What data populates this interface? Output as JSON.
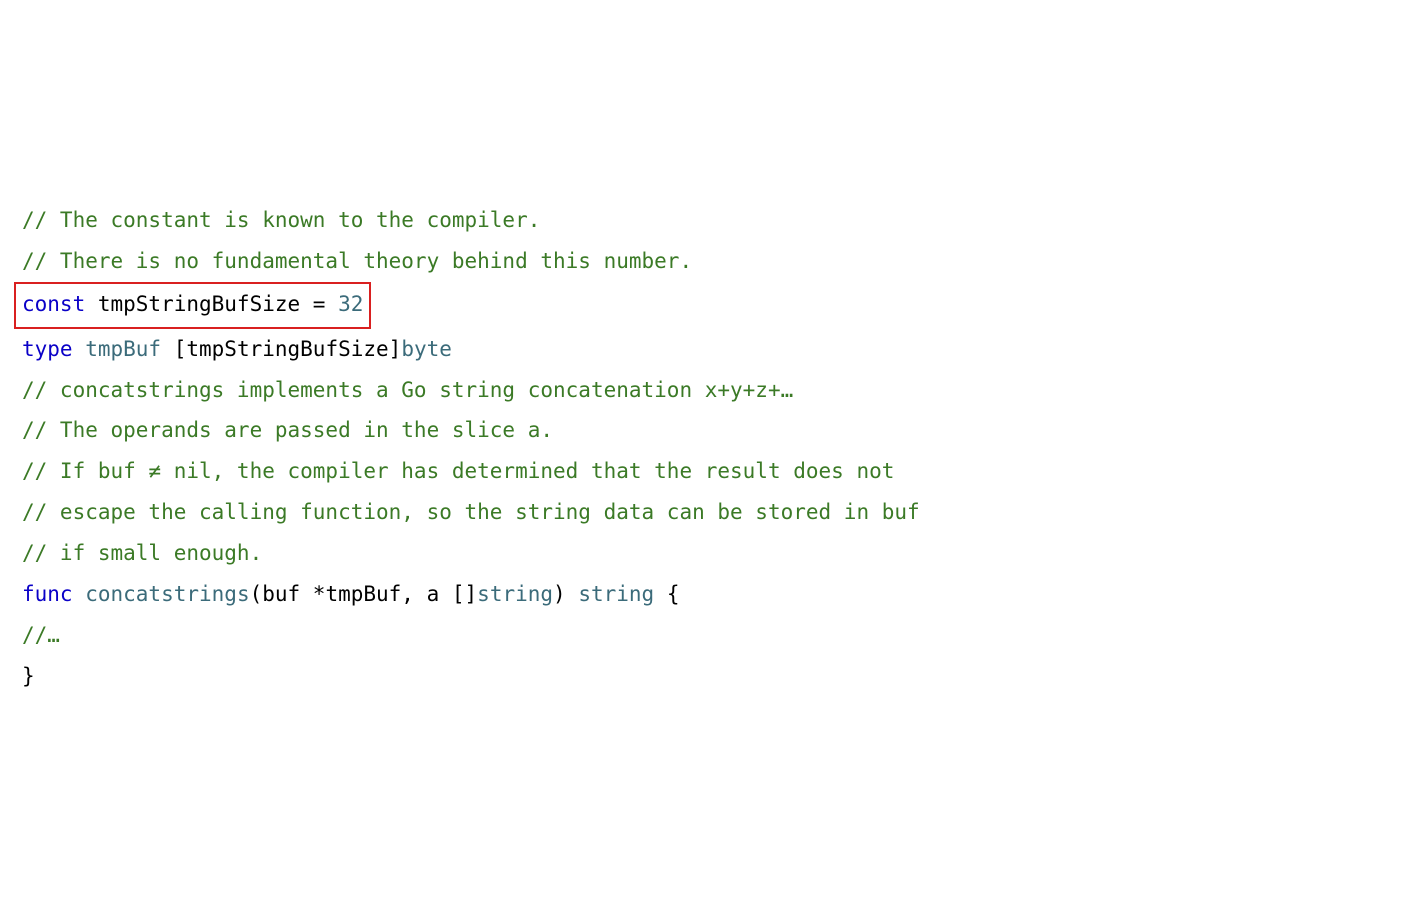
{
  "code": {
    "c1": "// The constant is known to the compiler.",
    "c2": "// There is no fundamental theory behind this number.",
    "kw_const": "const",
    "const_name": " tmpStringBufSize ",
    "eq": "= ",
    "const_val": "32",
    "blank": "",
    "kw_type": "type",
    "type_name": " tmpBuf",
    "type_body_open": " [tmpStringBufSize]",
    "type_byte": "byte",
    "c3": "// concatstrings implements a Go string concatenation x+y+z+…",
    "c4": "// The operands are passed in the slice a.",
    "c5": "// If buf ≠ nil, the compiler has determined that the result does not",
    "c6": "// escape the calling function, so the string data can be stored in buf",
    "c7": "// if small enough.",
    "kw_func": "func",
    "fn_name": " concatstrings",
    "params_open": "(buf *tmpBuf, a []",
    "str_type": "string",
    "params_mid": ") ",
    "ret_type": "string",
    "brace_open": " {",
    "c8": "//…",
    "brace_close": "}"
  }
}
